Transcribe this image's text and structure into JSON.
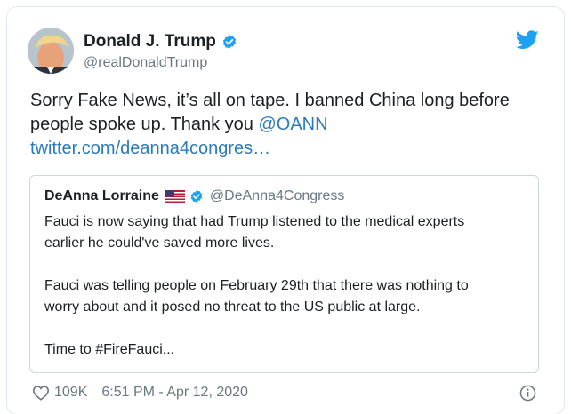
{
  "tweet": {
    "author": {
      "display_name": "Donald J. Trump",
      "handle": "@realDonaldTrump",
      "verified": true
    },
    "text_lines": [
      "Sorry Fake News, it’s all on tape. I banned China long before",
      "people spoke up. Thank you "
    ],
    "mention": "@OANN",
    "link": "twitter.com/deanna4congres…",
    "likes": "109K",
    "timestamp": "6:51 PM - Apr 12, 2020"
  },
  "quoted_tweet": {
    "display_name": "DeAnna Lorraine",
    "flag": "us-flag-icon",
    "verified": true,
    "handle": "@DeAnna4Congress",
    "paragraphs": [
      [
        "Fauci is now saying that had Trump listened to the medical experts",
        "earlier he could've saved more lives."
      ],
      [
        "Fauci was telling people on February 29th that there was nothing to",
        "worry about and it posed no threat to the US public at large."
      ],
      [
        "Time to #FireFauci..."
      ]
    ]
  },
  "colors": {
    "link": "#2b7bb9",
    "verified": "#1da1f2",
    "twitter_brand": "#1da1f2",
    "muted_text": "#697882",
    "border": "#e1e8ed"
  },
  "icons": [
    "verified-badge-icon",
    "twitter-bird-icon",
    "us-flag-icon",
    "heart-icon",
    "info-icon"
  ]
}
